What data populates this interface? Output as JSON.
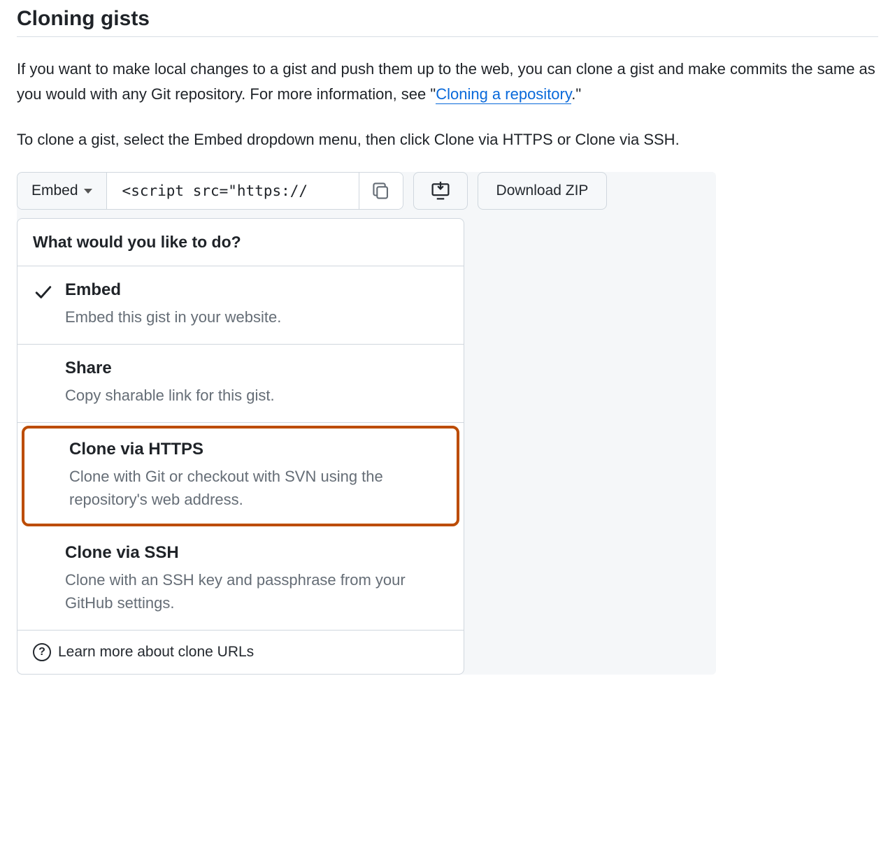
{
  "heading": "Cloning gists",
  "para1_pre": "If you want to make local changes to a gist and push them up to the web, you can clone a gist and make commits the same as you would with any Git repository. For more information, see \"",
  "para1_link": "Cloning a repository",
  "para1_post": ".\"",
  "para2": "To clone a gist, select the Embed dropdown menu, then click Clone via HTTPS or Clone via SSH.",
  "toolbar": {
    "embed_label": "Embed",
    "snippet": "<script src=\"https://",
    "download_label": "Download ZIP"
  },
  "dropdown": {
    "header": "What would you like to do?",
    "items": [
      {
        "title": "Embed",
        "desc": "Embed this gist in your website.",
        "selected": true,
        "highlighted": false
      },
      {
        "title": "Share",
        "desc": "Copy sharable link for this gist.",
        "selected": false,
        "highlighted": false
      },
      {
        "title": "Clone via HTTPS",
        "desc": "Clone with Git or checkout with SVN using the repository's web address.",
        "selected": false,
        "highlighted": true
      },
      {
        "title": "Clone via SSH",
        "desc": "Clone with an SSH key and passphrase from your GitHub settings.",
        "selected": false,
        "highlighted": false
      }
    ],
    "footer": "Learn more about clone URLs"
  }
}
